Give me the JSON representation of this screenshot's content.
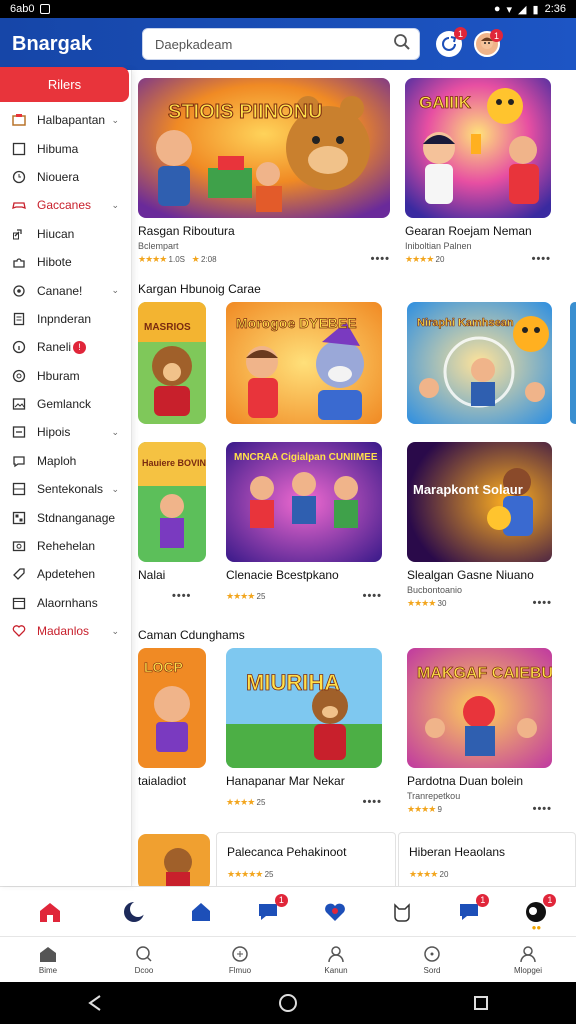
{
  "status_bar": {
    "left_text": "6ab0",
    "time": "2:36"
  },
  "header": {
    "app_title": "Bnargak",
    "search_placeholder": "Daepkadeam",
    "notif_badge": "1",
    "avatar_badge": "1",
    "colors": {
      "bar": "#1d4fb8",
      "accent_red": "#e8343b"
    }
  },
  "sidebar": {
    "header_label": "Rilers",
    "items": [
      {
        "label": "Halbapantan",
        "icon": "folder-icon",
        "chevron": true
      },
      {
        "label": "Hibuma",
        "icon": "square-icon"
      },
      {
        "label": "Niouera",
        "icon": "clock-icon"
      },
      {
        "label": "Gaccanes",
        "icon": "controller-icon",
        "chevron": true,
        "red": true
      },
      {
        "label": "Hiucan",
        "icon": "link-icon"
      },
      {
        "label": "Hibote",
        "icon": "puzzle-icon"
      },
      {
        "label": "Canane!",
        "icon": "settings-icon",
        "chevron": true
      },
      {
        "label": "Inpnderan",
        "icon": "document-icon"
      },
      {
        "label": "Raneli",
        "icon": "info-icon",
        "badge": "!"
      },
      {
        "label": "Hburam",
        "icon": "power-icon"
      },
      {
        "label": "Gemlanck",
        "icon": "image-icon"
      },
      {
        "label": "Hipois",
        "icon": "minus-box-icon",
        "chevron": true
      },
      {
        "label": "Maploh",
        "icon": "chat-icon"
      },
      {
        "label": "Sentekonals",
        "icon": "grid-icon",
        "chevron": true
      },
      {
        "label": "Stdnanganage",
        "icon": "layout-icon"
      },
      {
        "label": "Rehehelan",
        "icon": "camera-icon"
      },
      {
        "label": "Apdetehen",
        "icon": "tag-icon"
      },
      {
        "label": "Alaornhans",
        "icon": "calendar-icon"
      },
      {
        "label": "Madanlos",
        "icon": "heart-icon",
        "chevron": true,
        "red": true
      }
    ]
  },
  "main": {
    "featured": [
      {
        "title": "Rasgan Riboutura",
        "subtitle": "Bclempart",
        "rating_count": "1.0S",
        "rating_extra": "2:08",
        "thumb_text": "STIOIS PIINONU"
      },
      {
        "title": "Gearan Roejam Neman",
        "subtitle": "Iniboltian Palnen",
        "rating_count": "20",
        "thumb_text": "GAIIIK"
      }
    ],
    "section1_title": "Kargan Hbunoig Carae",
    "row1": [
      {
        "thumb_text": "MASRIOS"
      },
      {
        "thumb_text": "Morogoe DYEBEE"
      },
      {
        "thumb_text": "Niraphi Kamhsean"
      },
      {
        "thumb_text": ""
      }
    ],
    "row2": [
      {
        "title": "Nalai",
        "rating_count": "",
        "thumb_text": "Hauiere BOVINIEAS"
      },
      {
        "title": "Clenacie Bcestpkano",
        "rating_count": "25",
        "thumb_text": "MNCRAA Cigialpan CUNIIMEE"
      },
      {
        "title": "Slealgan Gasne Niuano",
        "subtitle": "Bucbontoanio",
        "rating_count": "30",
        "thumb_text": "Marapkont Solaur"
      }
    ],
    "section2_title": "Caman Cdunghams",
    "row3": [
      {
        "title": "taialadiot",
        "thumb_text": "LOCP"
      },
      {
        "title": "Hanapanar Mar Nekar",
        "rating_count": "25",
        "thumb_text": "MIURIHA"
      },
      {
        "title": "Pardotna Duan bolein",
        "subtitle": "Tranrepetkou",
        "rating_count": "9",
        "thumb_text": "MAKGAF CAIEBUS"
      }
    ],
    "row4": [
      {
        "title": "Palecanca Pehakinoot",
        "rating_count": "25"
      },
      {
        "title": "Hiberan Heaolans",
        "rating_count": "20"
      }
    ]
  },
  "bottom_nav": {
    "tabs": [
      {
        "label": "Bime",
        "icon": "home-icon"
      },
      {
        "label": "Dcoo",
        "icon": "search-icon"
      },
      {
        "label": "Flmuo",
        "icon": "game-icon"
      },
      {
        "label": "Kanun",
        "icon": "profile-group-icon"
      },
      {
        "label": "Sord",
        "icon": "compass-icon"
      },
      {
        "label": "Mlopgei",
        "icon": "person-icon"
      }
    ],
    "badges": [
      "1",
      "1",
      "1"
    ]
  }
}
